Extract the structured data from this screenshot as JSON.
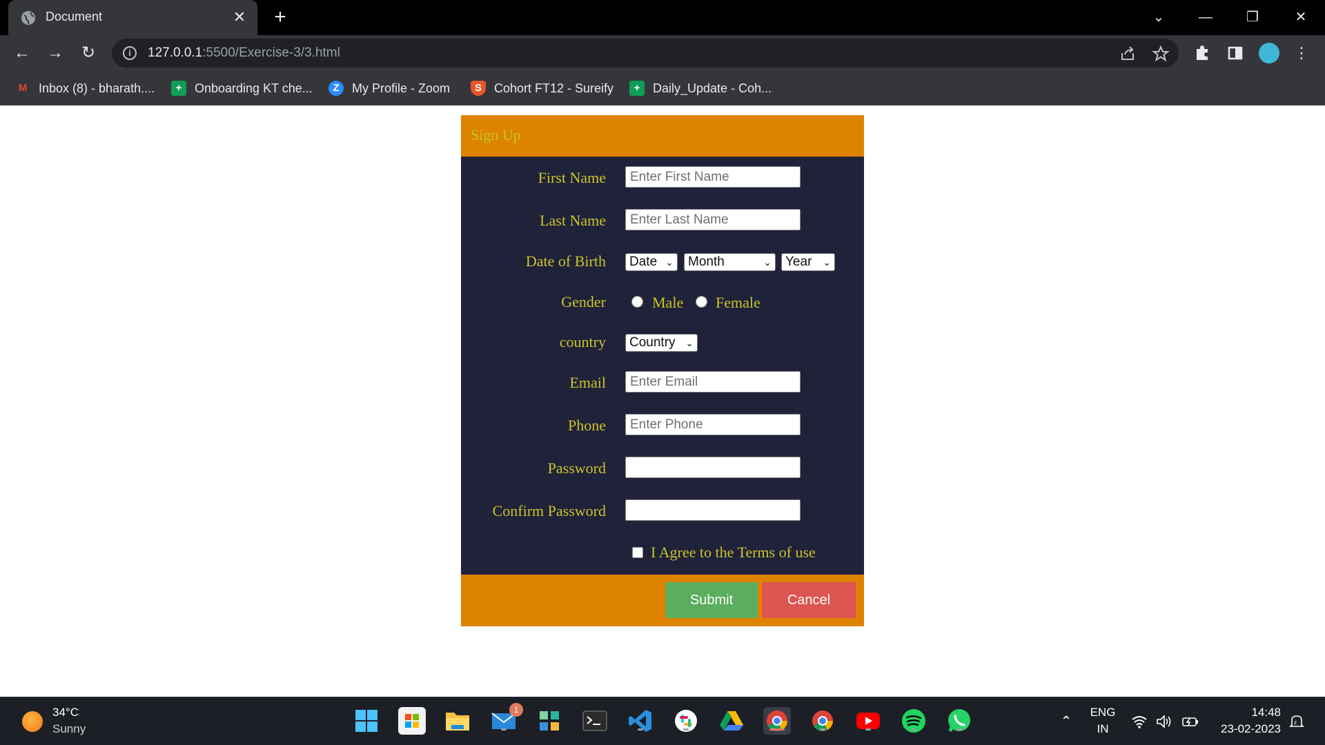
{
  "browser": {
    "tab_title": "Document",
    "tab_close": "✕",
    "new_tab": "+",
    "url_host": "127.0.0.1",
    "url_rest": ":5500/Exercise-3/3.html",
    "omnibox_info": "i",
    "window_controls": {
      "tab_search": "⌄",
      "minimize": "—",
      "restore": "❐",
      "close": "✕"
    },
    "nav": {
      "back": "←",
      "forward": "→",
      "reload": "↻"
    },
    "bookmarks": [
      {
        "label": "Inbox (8) - bharath....",
        "icon": "gmail-icon",
        "glyph": "M",
        "color": "#ea4335"
      },
      {
        "label": "Onboarding KT che...",
        "icon": "sheets-icon",
        "glyph": "+",
        "color": "#0f9d58"
      },
      {
        "label": "My Profile - Zoom",
        "icon": "zoom-icon",
        "glyph": "Z",
        "color": "#2d8cff"
      },
      {
        "label": "Cohort FT12 - Sureify",
        "icon": "sureify-icon",
        "glyph": "S",
        "color": "#e8552a"
      },
      {
        "label": "Daily_Update - Coh...",
        "icon": "sheets-icon",
        "glyph": "+",
        "color": "#0f9d58"
      }
    ]
  },
  "form": {
    "title": "Sign Up",
    "first_name": {
      "label": "First Name",
      "placeholder": "Enter First Name"
    },
    "last_name": {
      "label": "Last Name",
      "placeholder": "Enter Last Name"
    },
    "dob": {
      "label": "Date of Birth",
      "date": "Date",
      "month": "Month",
      "year": "Year"
    },
    "gender": {
      "label": "Gender",
      "male": "Male",
      "female": "Female"
    },
    "country": {
      "label": "country",
      "selected": "Country"
    },
    "email": {
      "label": "Email",
      "placeholder": "Enter Email"
    },
    "phone": {
      "label": "Phone",
      "placeholder": "Enter Phone"
    },
    "password": {
      "label": "Password"
    },
    "confirm_password": {
      "label": "Confirm Password"
    },
    "terms": "I Agree to the Terms of use",
    "submit": "Submit",
    "cancel": "Cancel",
    "colors": {
      "header": "#de8300",
      "body": "#20223a",
      "label": "#c9c42a",
      "submit": "#5aae5e",
      "cancel": "#dd5550"
    }
  },
  "taskbar": {
    "temperature": "34°C",
    "weather": "Sunny",
    "mail_badge": "1",
    "language_line1": "ENG",
    "language_line2": "IN",
    "time": "14:48",
    "date": "23-02-2023"
  }
}
